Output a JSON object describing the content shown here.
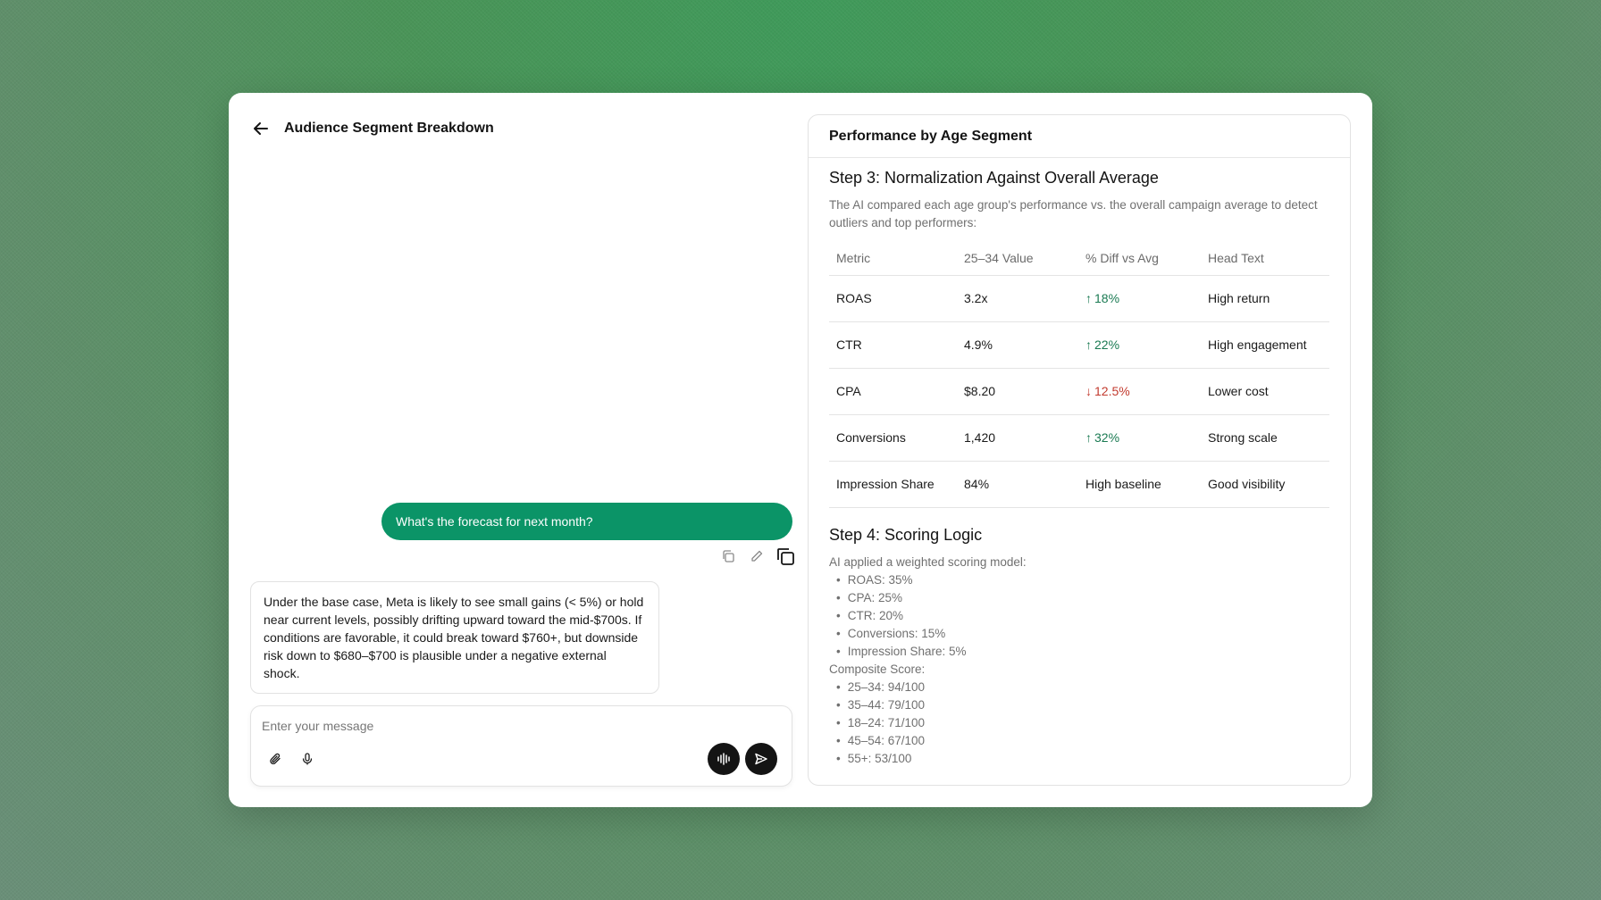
{
  "chat": {
    "title": "Audience Segment Breakdown",
    "user_message": "What's the forecast for next month?",
    "ai_message": "Under the base case, Meta is likely to see small gains (< 5%) or hold near current levels, possibly drifting upward toward the mid-$700s. If conditions are favorable, it could break toward $760+, but downside risk down to $680–$700 is plausible under a negative external shock.",
    "composer": {
      "placeholder": "Enter your message",
      "value": ""
    },
    "icons": {
      "back": "arrow-left-icon",
      "copy": "copy-icon",
      "edit": "pencil-icon",
      "duplicate": "duplicate-icon",
      "attach": "paperclip-icon",
      "mic": "microphone-icon",
      "voice": "waveform-icon",
      "send": "send-icon"
    }
  },
  "panel": {
    "title": "Performance by Age Segment",
    "step3": {
      "title": "Step 3: Normalization Against Overall Average",
      "description": "The AI compared each age group's performance vs. the overall campaign average to detect outliers and top performers:",
      "headers": [
        "Metric",
        "25–34 Value",
        "% Diff vs Avg",
        "Head Text"
      ],
      "rows": [
        {
          "metric": "ROAS",
          "value": "3.2x",
          "diff": "18%",
          "direction": "up",
          "text": "High return"
        },
        {
          "metric": "CTR",
          "value": "4.9%",
          "diff": "22%",
          "direction": "up",
          "text": "High engagement"
        },
        {
          "metric": "CPA",
          "value": "$8.20",
          "diff": "12.5%",
          "direction": "down",
          "text": "Lower cost"
        },
        {
          "metric": "Conversions",
          "value": "1,420",
          "diff": "32%",
          "direction": "up",
          "text": "Strong scale"
        },
        {
          "metric": "Impression Share",
          "value": "84%",
          "diff": "High baseline",
          "direction": "none",
          "text": "Good visibility"
        }
      ]
    },
    "step4": {
      "title": "Step 4: Scoring Logic",
      "intro": "AI applied a weighted scoring model:",
      "weights": [
        "ROAS: 35%",
        "CPA: 25%",
        "CTR: 20%",
        "Conversions: 15%",
        "Impression Share: 5%"
      ],
      "composite_label": "Composite Score:",
      "scores": [
        "25–34: 94/100",
        "35–44: 79/100",
        "18–24: 71/100",
        "45–54: 67/100",
        "55+: 53/100"
      ]
    }
  },
  "colors": {
    "accent": "#0b9467",
    "up": "#1a7a52",
    "down": "#c23a2e",
    "button_dark": "#141414"
  }
}
